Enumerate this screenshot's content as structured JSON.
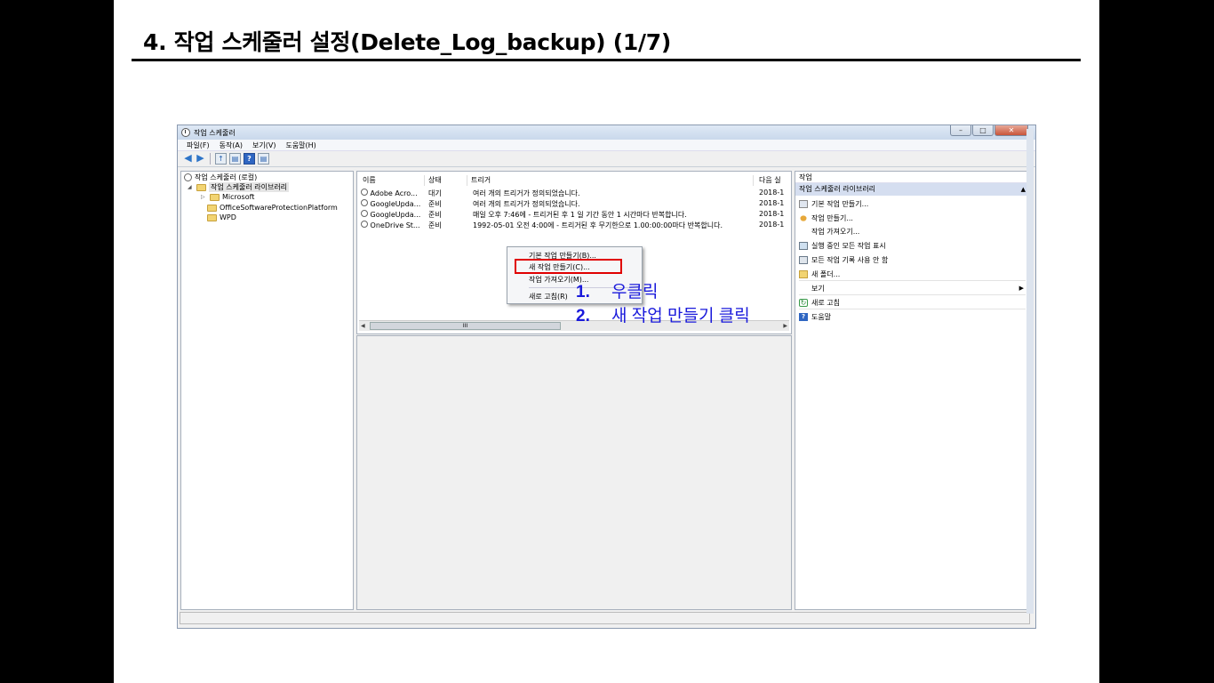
{
  "slide": {
    "title": "4. 작업 스케줄러 설정(Delete_Log_backup) (1/7)"
  },
  "window": {
    "title": "작업 스케줄러",
    "menu": [
      "파일(F)",
      "동작(A)",
      "보기(V)",
      "도움말(H)"
    ]
  },
  "tree": {
    "root": "작업 스케줄러 (로컬)",
    "library": "작업 스케줄러 라이브러리",
    "children": [
      "Microsoft",
      "OfficeSoftwareProtectionPlatform",
      "WPD"
    ]
  },
  "table": {
    "columns": [
      "이름",
      "상태",
      "트리거",
      "다음 실"
    ],
    "rows": [
      {
        "name": "Adobe Acro...",
        "status": "대기",
        "trigger": "여러 개의 트리거가 정의되었습니다.",
        "next": "2018-1"
      },
      {
        "name": "GoogleUpda...",
        "status": "준비",
        "trigger": "여러 개의 트리거가 정의되었습니다.",
        "next": "2018-1"
      },
      {
        "name": "GoogleUpda...",
        "status": "준비",
        "trigger": "매일 오후 7:46에 - 트리거된 후 1 일 기간 동안 1 시간마다 반복합니다.",
        "next": "2018-1"
      },
      {
        "name": "OneDrive St...",
        "status": "준비",
        "trigger": "1992-05-01 오전 4:00에 - 트리거된 후 무기한으로 1.00:00:00마다 반복합니다.",
        "next": "2018-1"
      }
    ],
    "scroll_thumb": "III"
  },
  "context_menu": {
    "items": [
      "기본 작업 만들기(B)...",
      "새 작업 만들기(C)...",
      "작업 가져오기(M)...",
      "새로 고침(R)"
    ]
  },
  "annotations": {
    "step1_num": "1.",
    "step1": "우클릭",
    "step2_num": "2.",
    "step2": "새 작업 만들기 클릭"
  },
  "actions": {
    "header": "작업",
    "group": "작업 스케줄러 라이브러리",
    "items": [
      "기본 작업 만들기...",
      "작업 만들기...",
      "작업 가져오기...",
      "실행 중인 모든 작업 표시",
      "모든 작업 기록 사용 안 함",
      "새 폴더...",
      "보기",
      "새로 고침",
      "도움말"
    ]
  },
  "colors": {
    "annotation": "#1a1adb",
    "highlight": "#e00000",
    "action_group_bg": "#d5def0"
  }
}
